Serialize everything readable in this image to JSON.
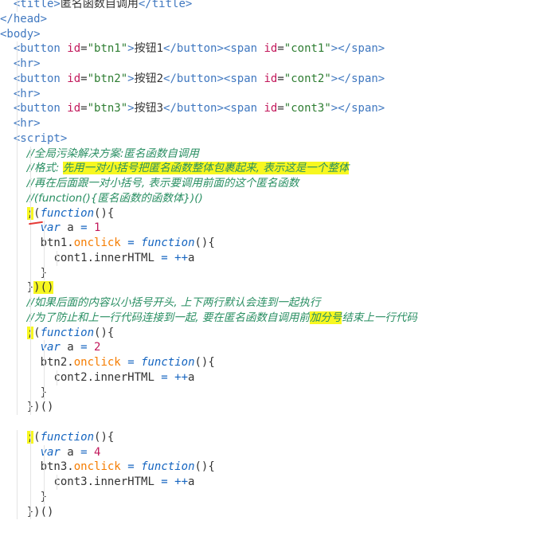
{
  "lines": [
    {
      "segments": [
        [
          "  ",
          "txt"
        ],
        [
          "<title>",
          "tag"
        ],
        [
          "匿名函数自调用",
          "txt"
        ],
        [
          "</title>",
          "tag"
        ]
      ]
    },
    {
      "segments": [
        [
          "</head>",
          "tag"
        ]
      ]
    },
    {
      "segments": [
        [
          "<body>",
          "tag"
        ]
      ]
    },
    {
      "segments": [
        [
          "  ",
          "txt"
        ],
        [
          "<button ",
          "tag"
        ],
        [
          "id",
          "attr"
        ],
        [
          "=",
          "txt"
        ],
        [
          "\"btn1\"",
          "str"
        ],
        [
          ">",
          "tag"
        ],
        [
          "按钮1",
          "txt"
        ],
        [
          "</button>",
          "tag"
        ],
        [
          "<span ",
          "tag"
        ],
        [
          "id",
          "attr"
        ],
        [
          "=",
          "txt"
        ],
        [
          "\"cont1\"",
          "str"
        ],
        [
          "></span>",
          "tag"
        ]
      ]
    },
    {
      "segments": [
        [
          "  ",
          "txt"
        ],
        [
          "<hr>",
          "tag"
        ]
      ]
    },
    {
      "segments": [
        [
          "  ",
          "txt"
        ],
        [
          "<button ",
          "tag"
        ],
        [
          "id",
          "attr"
        ],
        [
          "=",
          "txt"
        ],
        [
          "\"btn2\"",
          "str"
        ],
        [
          ">",
          "tag"
        ],
        [
          "按钮2",
          "txt"
        ],
        [
          "</button>",
          "tag"
        ],
        [
          "<span ",
          "tag"
        ],
        [
          "id",
          "attr"
        ],
        [
          "=",
          "txt"
        ],
        [
          "\"cont2\"",
          "str"
        ],
        [
          "></span>",
          "tag"
        ]
      ]
    },
    {
      "segments": [
        [
          "  ",
          "txt"
        ],
        [
          "<hr>",
          "tag"
        ]
      ]
    },
    {
      "segments": [
        [
          "  ",
          "txt"
        ],
        [
          "<button ",
          "tag"
        ],
        [
          "id",
          "attr"
        ],
        [
          "=",
          "txt"
        ],
        [
          "\"btn3\"",
          "str"
        ],
        [
          ">",
          "tag"
        ],
        [
          "按钮3",
          "txt"
        ],
        [
          "</button>",
          "tag"
        ],
        [
          "<span ",
          "tag"
        ],
        [
          "id",
          "attr"
        ],
        [
          "=",
          "txt"
        ],
        [
          "\"cont3\"",
          "str"
        ],
        [
          "></span>",
          "tag"
        ]
      ]
    },
    {
      "segments": [
        [
          "  ",
          "txt"
        ],
        [
          "<hr>",
          "tag"
        ]
      ]
    },
    {
      "segments": [
        [
          "  ",
          "txt"
        ],
        [
          "<script>",
          "tag"
        ]
      ]
    },
    {
      "segments": [
        [
          "    ",
          "txt"
        ],
        [
          "//全局污染解决方案:匿名函数自调用",
          "cmt"
        ]
      ]
    },
    {
      "segments": [
        [
          "    ",
          "txt"
        ],
        [
          "//格式: ",
          "cmt"
        ],
        [
          "先用一对小括号把匿名函数整体包裹起来, 表示这是一个整体",
          "cmt hl"
        ]
      ]
    },
    {
      "segments": [
        [
          "    ",
          "txt"
        ],
        [
          "//再在后面跟一对小括号, 表示要调用前面的这个匿名函数",
          "cmt"
        ]
      ]
    },
    {
      "segments": [
        [
          "    ",
          "txt"
        ],
        [
          "//(function(){匿名函数的函数体})()",
          "cmt"
        ]
      ]
    },
    {
      "segments": [
        [
          "    ",
          "txt"
        ],
        [
          ";",
          "punc hl"
        ],
        [
          "(",
          "punc"
        ],
        [
          "function",
          "kw"
        ],
        [
          "(){",
          "punc"
        ]
      ]
    },
    {
      "segments": [
        [
          "      ",
          "txt"
        ],
        [
          "var",
          "kw"
        ],
        [
          " a ",
          "txt"
        ],
        [
          "=",
          "op"
        ],
        [
          " ",
          "txt"
        ],
        [
          "1",
          "num"
        ]
      ]
    },
    {
      "segments": [
        [
          "      ",
          "txt"
        ],
        [
          "btn1.",
          "txt"
        ],
        [
          "onclick",
          "prop"
        ],
        [
          " ",
          "txt"
        ],
        [
          "=",
          "op"
        ],
        [
          " ",
          "txt"
        ],
        [
          "function",
          "kw"
        ],
        [
          "(){",
          "punc"
        ]
      ]
    },
    {
      "segments": [
        [
          "        ",
          "txt"
        ],
        [
          "cont1.innerHTML ",
          "txt"
        ],
        [
          "=",
          "op"
        ],
        [
          " ",
          "txt"
        ],
        [
          "++",
          "op"
        ],
        [
          "a",
          "txt"
        ]
      ]
    },
    {
      "segments": [
        [
          "      ",
          "txt"
        ],
        [
          "}",
          "punc"
        ]
      ]
    },
    {
      "segments": [
        [
          "    ",
          "txt"
        ],
        [
          "}",
          "punc"
        ],
        [
          ")()",
          "punc hl"
        ]
      ]
    },
    {
      "segments": [
        [
          "    ",
          "txt"
        ],
        [
          "//如果后面的内容以小括号开头, 上下两行默认会连到一起执行",
          "cmt"
        ]
      ]
    },
    {
      "segments": [
        [
          "    ",
          "txt"
        ],
        [
          "//为了防止和上一行代码连接到一起, 要在匿名函数自调用前",
          "cmt"
        ],
        [
          "加分号",
          "cmt hl"
        ],
        [
          "结束上一行代码",
          "cmt"
        ]
      ]
    },
    {
      "segments": [
        [
          "    ",
          "txt"
        ],
        [
          ";",
          "punc hl"
        ],
        [
          "(",
          "punc"
        ],
        [
          "function",
          "kw"
        ],
        [
          "(){",
          "punc"
        ]
      ]
    },
    {
      "segments": [
        [
          "      ",
          "txt"
        ],
        [
          "var",
          "kw"
        ],
        [
          " a ",
          "txt"
        ],
        [
          "=",
          "op"
        ],
        [
          " ",
          "txt"
        ],
        [
          "2",
          "num"
        ]
      ]
    },
    {
      "segments": [
        [
          "      ",
          "txt"
        ],
        [
          "btn2.",
          "txt"
        ],
        [
          "onclick",
          "prop"
        ],
        [
          " ",
          "txt"
        ],
        [
          "=",
          "op"
        ],
        [
          " ",
          "txt"
        ],
        [
          "function",
          "kw"
        ],
        [
          "(){",
          "punc"
        ]
      ]
    },
    {
      "segments": [
        [
          "        ",
          "txt"
        ],
        [
          "cont2.innerHTML ",
          "txt"
        ],
        [
          "=",
          "op"
        ],
        [
          " ",
          "txt"
        ],
        [
          "++",
          "op"
        ],
        [
          "a",
          "txt"
        ]
      ]
    },
    {
      "segments": [
        [
          "      ",
          "txt"
        ],
        [
          "}",
          "punc"
        ]
      ]
    },
    {
      "segments": [
        [
          "    ",
          "txt"
        ],
        [
          "})()",
          "punc"
        ]
      ]
    },
    {
      "segments": [
        [
          "",
          "txt"
        ]
      ]
    },
    {
      "segments": [
        [
          "    ",
          "txt"
        ],
        [
          ";",
          "punc hl"
        ],
        [
          "(",
          "punc"
        ],
        [
          "function",
          "kw"
        ],
        [
          "(){",
          "punc"
        ]
      ]
    },
    {
      "segments": [
        [
          "      ",
          "txt"
        ],
        [
          "var",
          "kw"
        ],
        [
          " a ",
          "txt"
        ],
        [
          "=",
          "op"
        ],
        [
          " ",
          "txt"
        ],
        [
          "4",
          "num"
        ]
      ]
    },
    {
      "segments": [
        [
          "      ",
          "txt"
        ],
        [
          "btn3.",
          "txt"
        ],
        [
          "onclick",
          "prop"
        ],
        [
          " ",
          "txt"
        ],
        [
          "=",
          "op"
        ],
        [
          " ",
          "txt"
        ],
        [
          "function",
          "kw"
        ],
        [
          "(){",
          "punc"
        ]
      ]
    },
    {
      "segments": [
        [
          "        ",
          "txt"
        ],
        [
          "cont3.innerHTML ",
          "txt"
        ],
        [
          "=",
          "op"
        ],
        [
          " ",
          "txt"
        ],
        [
          "++",
          "op"
        ],
        [
          "a",
          "txt"
        ]
      ]
    },
    {
      "segments": [
        [
          "      ",
          "txt"
        ],
        [
          "}",
          "punc"
        ]
      ]
    },
    {
      "segments": [
        [
          "    ",
          "txt"
        ],
        [
          "})()",
          "punc"
        ]
      ]
    },
    {
      "segments": [
        [
          "",
          "txt"
        ]
      ]
    }
  ]
}
